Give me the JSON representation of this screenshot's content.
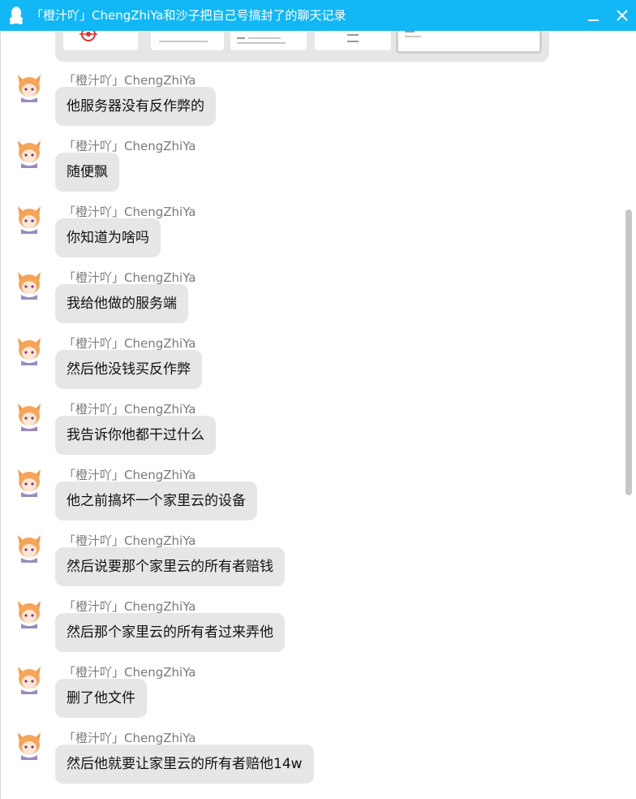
{
  "window": {
    "title": "「橙汁吖」ChengZhiYa和沙子把自己号搞封了的聊天记录",
    "accent": "#12b7f5",
    "minimize_glyph": "minimize-icon",
    "close_glyph": "close-icon"
  },
  "messages": [
    {
      "sender": "「橙汁吖」ChengZhiYa",
      "text": "他服务器没有反作弊的"
    },
    {
      "sender": "「橙汁吖」ChengZhiYa",
      "text": "随便飘"
    },
    {
      "sender": "「橙汁吖」ChengZhiYa",
      "text": "你知道为啥吗"
    },
    {
      "sender": "「橙汁吖」ChengZhiYa",
      "text": "我给他做的服务端"
    },
    {
      "sender": "「橙汁吖」ChengZhiYa",
      "text": "然后他没钱买反作弊"
    },
    {
      "sender": "「橙汁吖」ChengZhiYa",
      "text": "我告诉你他都干过什么"
    },
    {
      "sender": "「橙汁吖」ChengZhiYa",
      "text": "他之前搞坏一个家里云的设备"
    },
    {
      "sender": "「橙汁吖」ChengZhiYa",
      "text": "然后说要那个家里云的所有者赔钱"
    },
    {
      "sender": "「橙汁吖」ChengZhiYa",
      "text": "然后那个家里云的所有者过来弄他"
    },
    {
      "sender": "「橙汁吖」ChengZhiYa",
      "text": "删了他文件"
    },
    {
      "sender": "「橙汁吖」ChengZhiYa",
      "text": "然后他就要让家里云的所有者赔他14w"
    }
  ]
}
